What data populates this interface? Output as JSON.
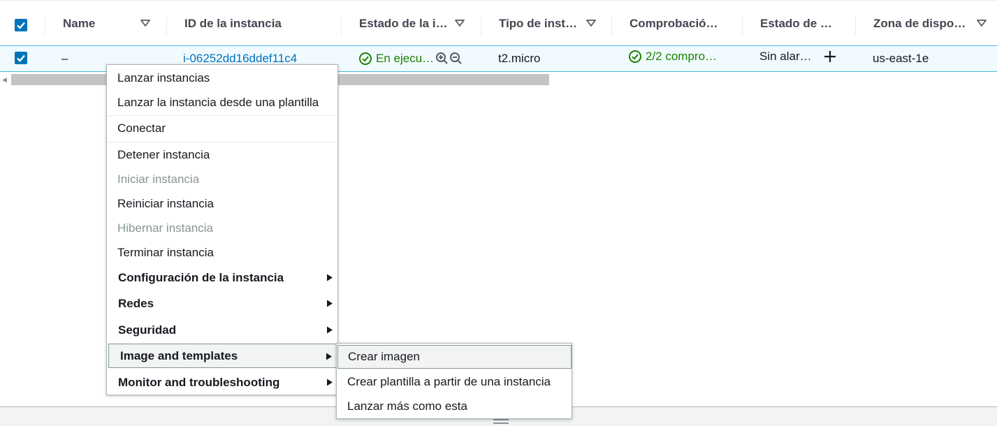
{
  "table": {
    "headers": {
      "name": "Name",
      "instance_id": "ID de la instancia",
      "instance_state": "Estado de la i…",
      "instance_type": "Tipo de inst…",
      "status_check": "Comprobació…",
      "alarm_status": "Estado de …",
      "availability_zone": "Zona de dispo…"
    },
    "row": {
      "name": "–",
      "instance_id": "i-06252dd16ddef11c4",
      "instance_state": "En ejecu…",
      "instance_type": "t2.micro",
      "status_check": "2/2 compro…",
      "alarm_status": "Sin alar…",
      "availability_zone": "us-east-1e"
    }
  },
  "context_menu": {
    "launch_instances": "Lanzar instancias",
    "launch_from_template": "Lanzar la instancia desde una plantilla",
    "connect": "Conectar",
    "stop": "Detener instancia",
    "start": "Iniciar instancia",
    "reboot": "Reiniciar instancia",
    "hibernate": "Hibernar instancia",
    "terminate": "Terminar instancia",
    "instance_settings": "Configuración de la instancia",
    "networking": "Redes",
    "security": "Seguridad",
    "image_templates": "Image and templates",
    "monitor": "Monitor and troubleshooting"
  },
  "submenu": {
    "create_image": "Crear imagen",
    "create_template": "Crear plantilla a partir de una instancia",
    "launch_more": "Lanzar más como esta"
  },
  "colors": {
    "accent": "#0073bb",
    "success": "#1d8102",
    "selected_row_bg": "#f1faff",
    "selected_row_border": "#44b9d6"
  }
}
